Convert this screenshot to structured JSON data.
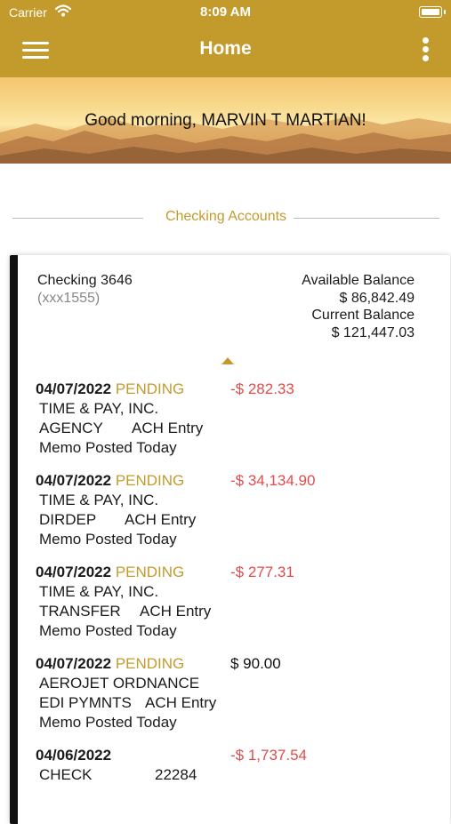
{
  "status_bar": {
    "carrier": "Carrier",
    "time": "8:09 AM"
  },
  "nav": {
    "title": "Home"
  },
  "banner": {
    "greeting": "Good morning, MARVIN T MARTIAN!"
  },
  "section": {
    "title": "Checking Accounts"
  },
  "account": {
    "name": "Checking 3646",
    "mask": "(xxx1555)",
    "available_label": "Available Balance",
    "available_value": "$ 86,842.49",
    "current_label": "Current Balance",
    "current_value": "$ 121,447.03"
  },
  "transactions": [
    {
      "date": "04/07/2022",
      "status": "PENDING",
      "amount": "-$ 282.33",
      "payee": "TIME & PAY, INC.",
      "desc1": "AGENCY",
      "desc2": "ACH Entry",
      "memo": "Memo Posted Today"
    },
    {
      "date": "04/07/2022",
      "status": "PENDING",
      "amount": "-$ 34,134.90",
      "payee": "TIME & PAY, INC.",
      "desc1": "DIRDEP",
      "desc2": "ACH Entry",
      "memo": "Memo Posted Today"
    },
    {
      "date": "04/07/2022",
      "status": "PENDING",
      "amount": "-$ 277.31",
      "payee": "TIME & PAY, INC.",
      "desc1": "TRANSFER",
      "desc2": "ACH Entry",
      "memo": "Memo Posted Today"
    },
    {
      "date": "04/07/2022",
      "status": "PENDING",
      "amount": "$ 90.00",
      "payee": "AEROJET ORDNANCE",
      "desc1": "EDI PYMNTS",
      "desc2": "ACH Entry",
      "memo": "Memo Posted Today"
    },
    {
      "date": "04/06/2022",
      "status": "",
      "amount": "-$ 1,737.54",
      "payee": "CHECK",
      "desc1": "22284"
    }
  ],
  "colors": {
    "brand": "#c39b2c",
    "negative": "#e24b4b"
  },
  "icons": {
    "menu": "hamburger-menu-icon",
    "more": "more-vertical-icon",
    "wifi": "wifi-icon",
    "battery": "battery-icon",
    "collapse": "caret-up-icon"
  }
}
